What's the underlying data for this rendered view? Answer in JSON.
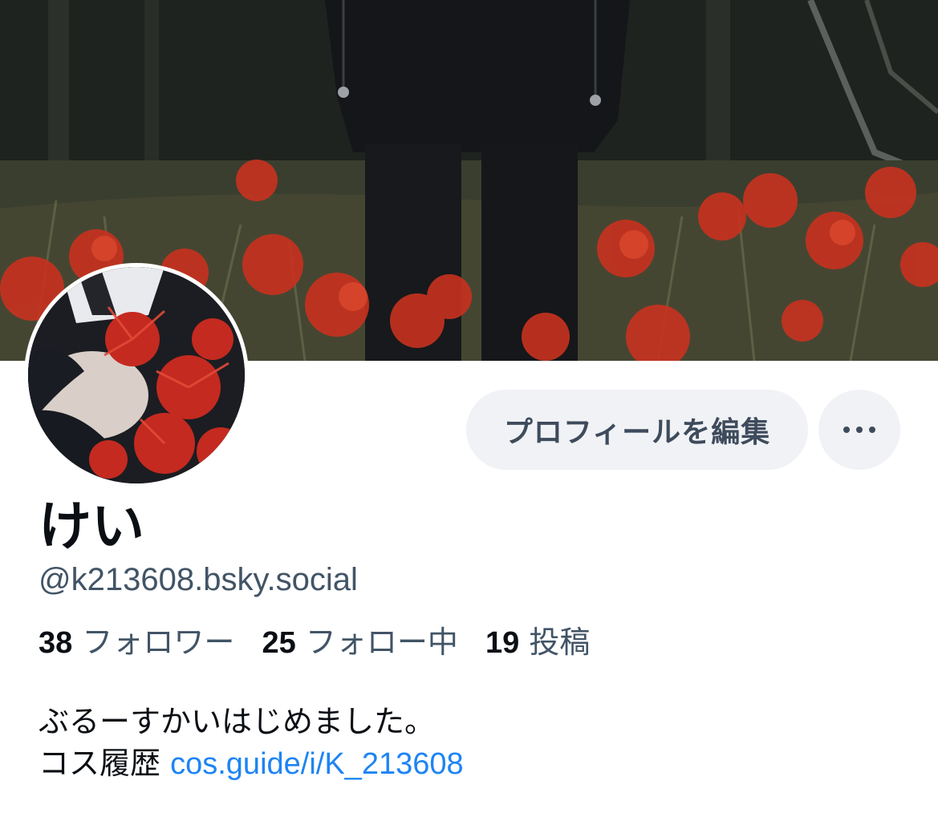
{
  "profile": {
    "display_name": "けい",
    "handle": "@k213608.bsky.social",
    "stats": {
      "followers_count": "38",
      "followers_label": "フォロワー",
      "following_count": "25",
      "following_label": "フォロー中",
      "posts_count": "19",
      "posts_label": "投稿"
    },
    "bio": {
      "line1": "ぶるーすかいはじめました。",
      "line2_prefix": "コス履歴",
      "link_text": "cos.guide/i/K_213608"
    }
  },
  "actions": {
    "edit_profile_label": "プロフィールを編集",
    "more_icon": "ellipsis-icon"
  },
  "images": {
    "banner": "banner-image",
    "avatar": "avatar-image"
  },
  "colors": {
    "button_bg": "#f0f2f5",
    "button_text": "#3e4b5c",
    "muted_text": "#425466",
    "link": "#1d84f4",
    "primary_text": "#0b0f14"
  }
}
